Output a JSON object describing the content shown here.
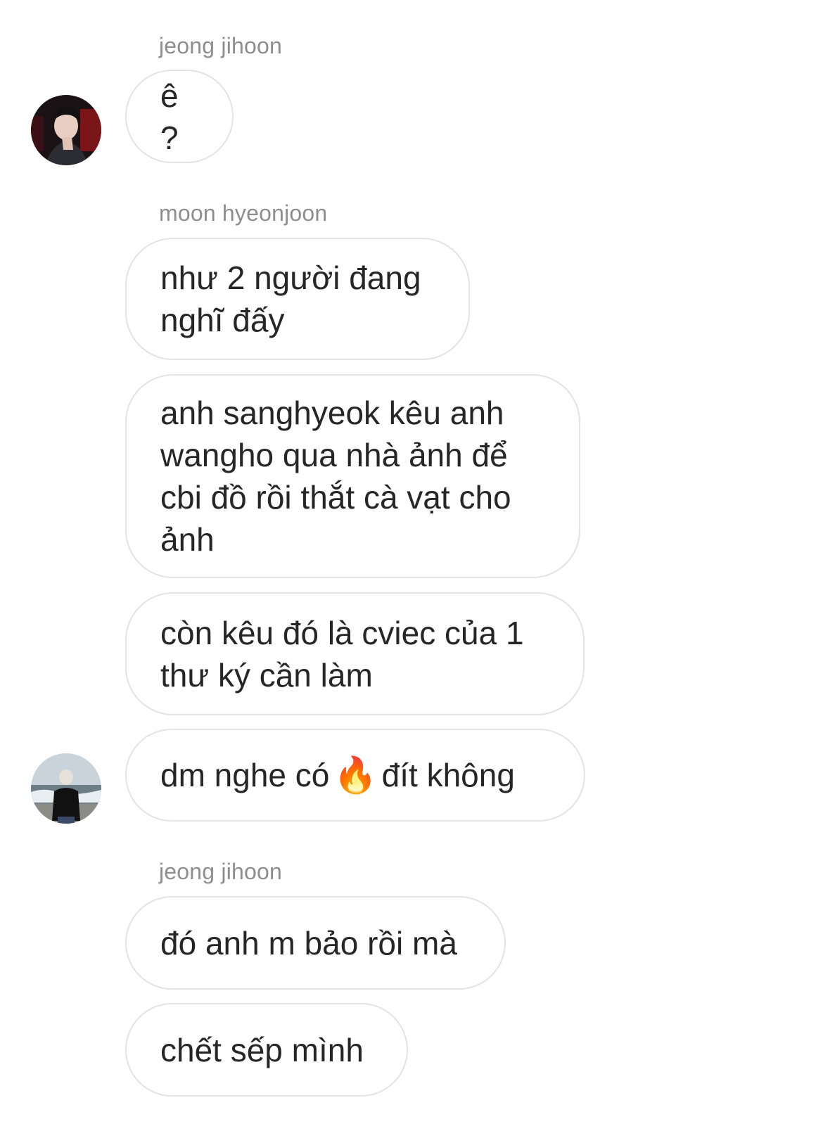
{
  "messages": [
    {
      "sender": "jeong jihoon",
      "text": "ê ?"
    },
    {
      "sender": "moon hyeonjoon",
      "text": "như 2 người đang\nnghĩ đấy"
    },
    {
      "text": "anh sanghyeok kêu anh\nwangho qua nhà ảnh để\ncbi đồ rồi thắt cà vạt cho\nảnh"
    },
    {
      "text": "còn kêu đó là cviec của 1\nthư ký cần làm"
    },
    {
      "text_before": "dm nghe có",
      "emoji": "🔥",
      "text_after": "đít không"
    },
    {
      "sender": "jeong jihoon",
      "text": "đó anh m bảo rồi mà"
    },
    {
      "text": "chết sếp mình"
    }
  ],
  "avatars": [
    {
      "icon": "profile-photo-jeong-jihoon"
    },
    {
      "icon": "profile-photo-moon-hyeonjoon"
    }
  ],
  "colors": {
    "bubble_border": "#e3e3e3",
    "sender_name": "#8e8e8e",
    "message_text": "#262626",
    "background": "#ffffff"
  }
}
